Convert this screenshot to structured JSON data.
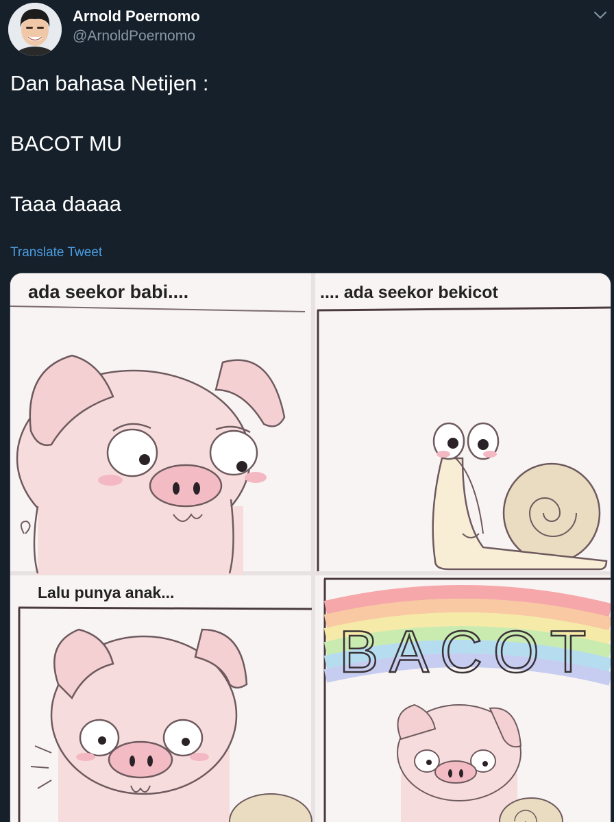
{
  "author": {
    "display_name": "Arnold Poernomo",
    "handle": "@ArnoldPoernomo"
  },
  "tweet": {
    "lines": [
      "Dan bahasa Netijen :",
      "BACOT MU",
      "Taaa daaaa"
    ],
    "translate_label": "Translate Tweet"
  },
  "comic": {
    "panel1_caption": "ada seekor babi....",
    "panel2_caption": ".... ada seekor bekicot",
    "panel3_caption": "Lalu punya anak...",
    "panel4_word": "BACOT"
  },
  "colors": {
    "background": "#15202b",
    "secondary_text": "#8899a6",
    "link": "#4b9ce0",
    "pig_pink": "#f6d6d8",
    "snail_shell": "#e9dcc0"
  },
  "icons": {
    "caret": "chevron-down-icon",
    "avatar": "avatar"
  }
}
